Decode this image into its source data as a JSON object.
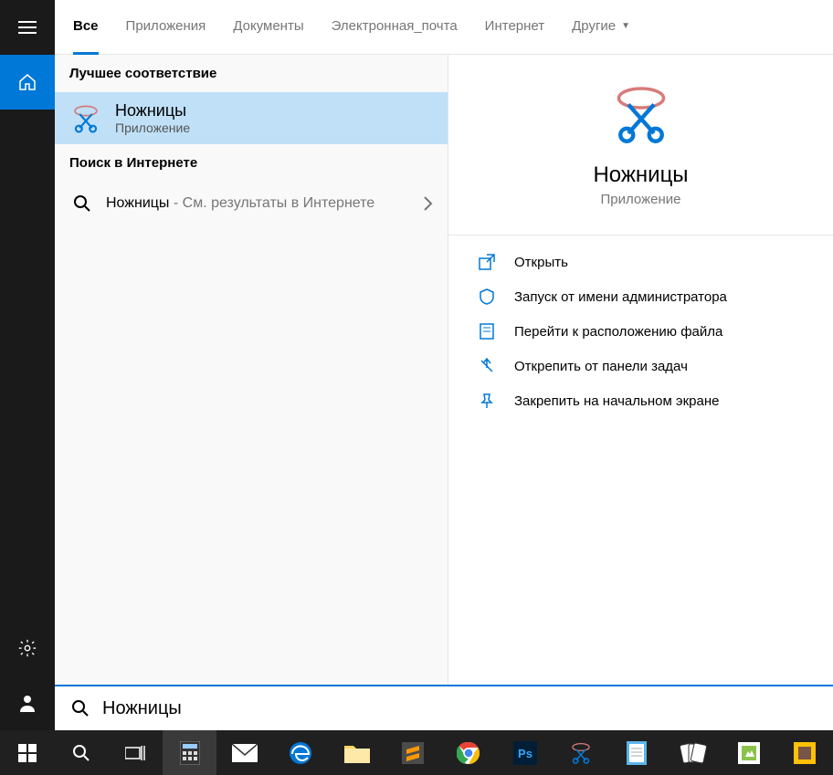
{
  "tabs": {
    "all": "Все",
    "apps": "Приложения",
    "docs": "Документы",
    "email": "Электронная_почта",
    "internet": "Интернет",
    "other": "Другие"
  },
  "sections": {
    "best_match": "Лучшее соответствие",
    "web_search": "Поиск в Интернете"
  },
  "best_match_item": {
    "title": "Ножницы",
    "subtitle": "Приложение"
  },
  "web_item": {
    "query": "Ножницы",
    "suffix": " - См. результаты в Интернете"
  },
  "preview": {
    "title": "Ножницы",
    "subtitle": "Приложение"
  },
  "actions": {
    "open": "Открыть",
    "run_admin": "Запуск от имени администратора",
    "file_location": "Перейти к расположению файла",
    "unpin_taskbar": "Открепить от панели задач",
    "pin_start": "Закрепить на начальном экране"
  },
  "search": {
    "value": "Ножницы"
  },
  "colors": {
    "accent": "#0078d7"
  }
}
